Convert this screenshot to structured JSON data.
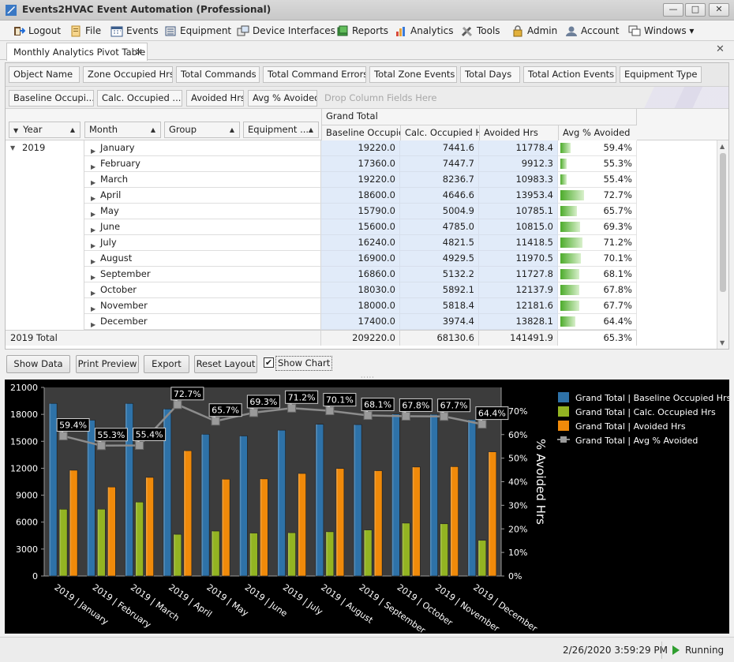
{
  "window": {
    "title": "Events2HVAC Event Automation (Professional)",
    "buttons": {
      "minimize": "—",
      "maximize": "□",
      "close": "✕"
    }
  },
  "menu": [
    {
      "label": "Logout",
      "icon": "logout-icon"
    },
    {
      "label": "File",
      "icon": "file-icon"
    },
    {
      "label": "Events",
      "icon": "calendar-icon"
    },
    {
      "label": "Equipment",
      "icon": "equipment-icon"
    },
    {
      "label": "Device Interfaces",
      "icon": "device-icon"
    },
    {
      "label": "Reports",
      "icon": "reports-icon"
    },
    {
      "label": "Analytics",
      "icon": "analytics-icon"
    },
    {
      "label": "Tools",
      "icon": "tools-icon"
    },
    {
      "label": "Admin",
      "icon": "lock-icon"
    },
    {
      "label": "Account",
      "icon": "account-icon"
    },
    {
      "label": "Windows ▾",
      "icon": "windows-icon"
    }
  ],
  "tab": {
    "label": "Monthly Analytics Pivot Table",
    "close": "✕"
  },
  "pivot": {
    "filter_fields": [
      "Object Name",
      "Zone Occupied Hrs",
      "Total Commands",
      "Total Command Errors",
      "Total Zone Events",
      "Total Days",
      "Total Action Events",
      "Equipment Type"
    ],
    "data_fields": [
      "Baseline Occupi...",
      "Calc. Occupied ...",
      "Avoided Hrs",
      "Avg % Avoided"
    ],
    "drop_hint": "Drop Column Fields Here",
    "row_fields": [
      "Year",
      "Month",
      "Group",
      "Equipment ..."
    ],
    "grand_total": "Grand Total",
    "columns": [
      "Baseline Occupie...",
      "Calc. Occupied Hrs",
      "Avoided Hrs",
      "Avg % Avoided"
    ],
    "year": "2019",
    "rows": [
      {
        "month": "January",
        "baseline": "19220.0",
        "calc": "7441.6",
        "avoided": "11778.4",
        "pct": "59.4%",
        "pct_value": 59.4
      },
      {
        "month": "February",
        "baseline": "17360.0",
        "calc": "7447.7",
        "avoided": "9912.3",
        "pct": "55.3%",
        "pct_value": 55.3
      },
      {
        "month": "March",
        "baseline": "19220.0",
        "calc": "8236.7",
        "avoided": "10983.3",
        "pct": "55.4%",
        "pct_value": 55.4
      },
      {
        "month": "April",
        "baseline": "18600.0",
        "calc": "4646.6",
        "avoided": "13953.4",
        "pct": "72.7%",
        "pct_value": 72.7
      },
      {
        "month": "May",
        "baseline": "15790.0",
        "calc": "5004.9",
        "avoided": "10785.1",
        "pct": "65.7%",
        "pct_value": 65.7
      },
      {
        "month": "June",
        "baseline": "15600.0",
        "calc": "4785.0",
        "avoided": "10815.0",
        "pct": "69.3%",
        "pct_value": 69.3
      },
      {
        "month": "July",
        "baseline": "16240.0",
        "calc": "4821.5",
        "avoided": "11418.5",
        "pct": "71.2%",
        "pct_value": 71.2
      },
      {
        "month": "August",
        "baseline": "16900.0",
        "calc": "4929.5",
        "avoided": "11970.5",
        "pct": "70.1%",
        "pct_value": 70.1
      },
      {
        "month": "September",
        "baseline": "16860.0",
        "calc": "5132.2",
        "avoided": "11727.8",
        "pct": "68.1%",
        "pct_value": 68.1
      },
      {
        "month": "October",
        "baseline": "18030.0",
        "calc": "5892.1",
        "avoided": "12137.9",
        "pct": "67.8%",
        "pct_value": 67.8
      },
      {
        "month": "November",
        "baseline": "18000.0",
        "calc": "5818.4",
        "avoided": "12181.6",
        "pct": "67.7%",
        "pct_value": 67.7
      },
      {
        "month": "December",
        "baseline": "17400.0",
        "calc": "3974.4",
        "avoided": "13828.1",
        "pct": "64.4%",
        "pct_value": 64.4
      }
    ],
    "total": {
      "label": "2019 Total",
      "baseline": "209220.0",
      "calc": "68130.6",
      "avoided": "141491.9",
      "pct": "65.3%"
    }
  },
  "toolbar": {
    "show_data": "Show Data",
    "print_preview": "Print Preview",
    "export": "Export",
    "reset_layout": "Reset Layout",
    "show_chart": "Show Chart",
    "show_chart_checked": "✔"
  },
  "chart_data": {
    "type": "bar",
    "categories": [
      "2019 | January",
      "2019 | February",
      "2019 | March",
      "2019 | April",
      "2019 | May",
      "2019 | June",
      "2019 | July",
      "2019 | August",
      "2019 | September",
      "2019 | October",
      "2019 | November",
      "2019 | December"
    ],
    "series": [
      {
        "name": "Grand Total | Baseline Occupied Hrs",
        "values": [
          19220,
          17360,
          19220,
          18600,
          15790,
          15600,
          16240,
          16900,
          16860,
          18030,
          18000,
          17400
        ],
        "color": "#2e72a8"
      },
      {
        "name": "Grand Total | Calc. Occupied Hrs",
        "values": [
          7441.6,
          7447.7,
          8236.7,
          4646.6,
          5004.9,
          4785.0,
          4821.5,
          4929.5,
          5132.2,
          5892.1,
          5818.4,
          3974.4
        ],
        "color": "#93b422"
      },
      {
        "name": "Grand Total | Avoided Hrs",
        "values": [
          11778.4,
          9912.3,
          10983.3,
          13953.4,
          10785.1,
          10815.0,
          11418.5,
          11970.5,
          11727.8,
          12137.9,
          12181.6,
          13828.1
        ],
        "color": "#f08a0a"
      },
      {
        "name": "Grand Total | Avg % Avoided",
        "type": "line",
        "axis": "secondary",
        "values": [
          59.4,
          55.3,
          55.4,
          72.7,
          65.7,
          69.3,
          71.2,
          70.1,
          68.1,
          67.8,
          67.7,
          64.4
        ],
        "labels": [
          "59.4%",
          "55.3%",
          "55.4%",
          "72.7%",
          "65.7%",
          "69.3%",
          "71.2%",
          "70.1%",
          "68.1%",
          "67.8%",
          "67.7%",
          "64.4%"
        ],
        "color": "#8c8c8c"
      }
    ],
    "y_ticks": [
      "0",
      "3000",
      "6000",
      "9000",
      "12000",
      "15000",
      "18000",
      "21000"
    ],
    "ylim": [
      0,
      21000
    ],
    "y2_ticks": [
      "0%",
      "10%",
      "20%",
      "30%",
      "40%",
      "50%",
      "60%",
      "70%"
    ],
    "y2lim": [
      0,
      80
    ],
    "y2label": "% Avoided Hrs",
    "legend_position": "right",
    "background": "#000000",
    "plot_background": "#3c3c3c"
  },
  "status": {
    "datetime": "2/26/2020 3:59:29 PM",
    "state": "Running"
  }
}
